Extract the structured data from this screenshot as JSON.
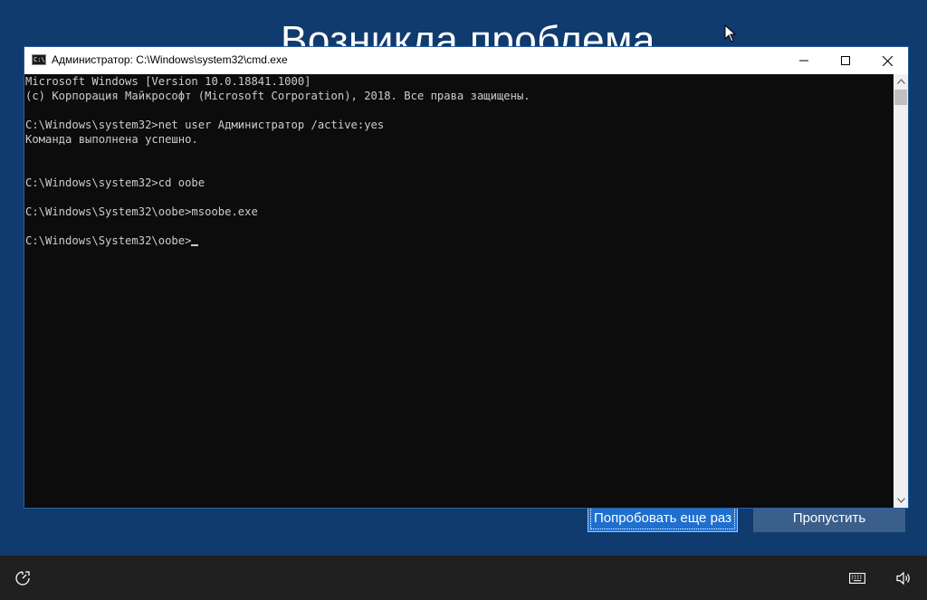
{
  "background": {
    "title": "Возникла проблема",
    "color": "#0f3b6e"
  },
  "buttons": {
    "retry_label": "Попробовать еще раз",
    "skip_label": "Пропустить"
  },
  "cmd": {
    "window_title": "Администратор: C:\\Windows\\system32\\cmd.exe",
    "app_icon_text": "C:\\",
    "lines": [
      "Microsoft Windows [Version 10.0.18841.1000]",
      "(c) Корпорация Майкрософт (Microsoft Corporation), 2018. Все права защищены.",
      "",
      "C:\\Windows\\system32>net user Администратор /active:yes",
      "Команда выполнена успешно.",
      "",
      "",
      "C:\\Windows\\system32>cd oobe",
      "",
      "C:\\Windows\\System32\\oobe>msoobe.exe",
      "",
      "C:\\Windows\\System32\\oobe>"
    ],
    "controls": {
      "minimize": "minimize-icon",
      "maximize": "maximize-icon",
      "close": "close-icon"
    }
  },
  "taskbar": {
    "left_icon": "ease-of-access-icon",
    "right_icons": [
      "keyboard-icon",
      "volume-icon"
    ]
  }
}
